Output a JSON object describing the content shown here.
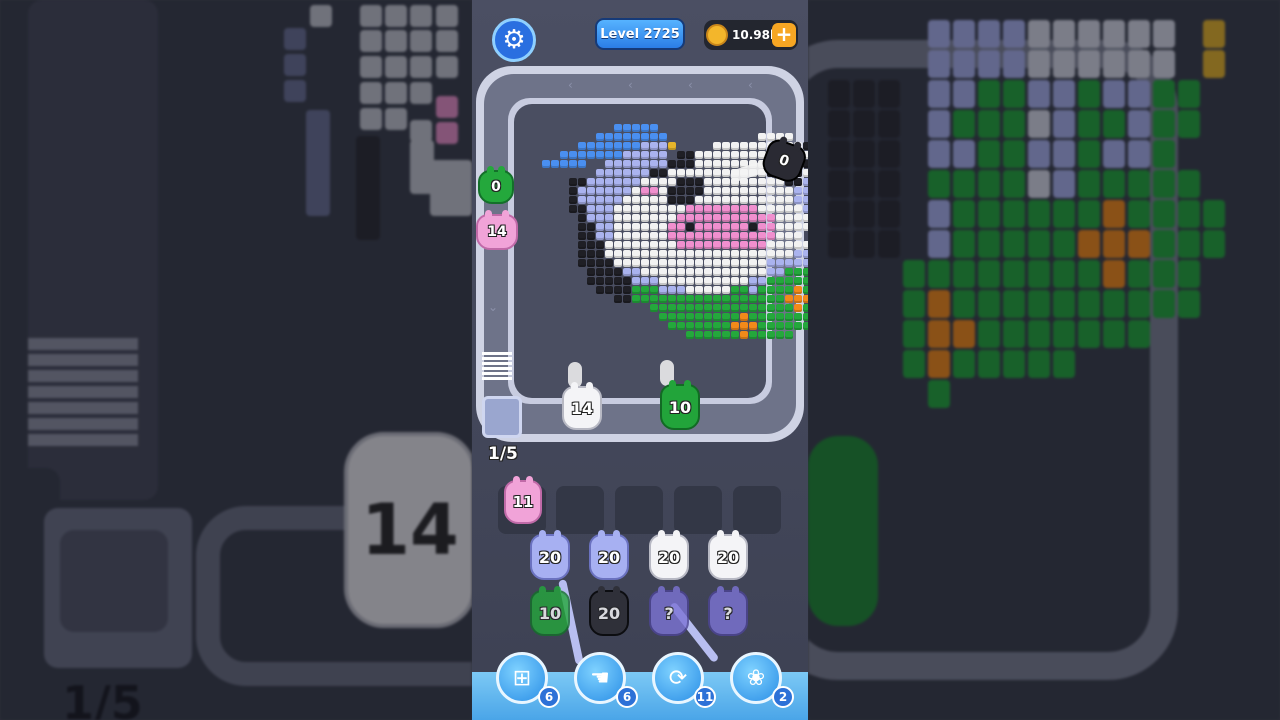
{
  "hud": {
    "level_label": "Level 2725",
    "coins": "10.98k",
    "coin_plus": "+"
  },
  "colors": {
    "cow_white": "#f2f2f2",
    "cow_black": "#1f1f25",
    "cow_pink": "#f08fce",
    "blue": "#4a8ff0",
    "lavender": "#aab3ee",
    "green": "#24a83c",
    "orange": "#f28a1a",
    "yellow": "#e6b52a"
  },
  "conveyor_shooters": [
    {
      "id": "green-left",
      "count": "0",
      "color": "#24a83c"
    },
    {
      "id": "pink-left",
      "count": "14",
      "color": "#f1a3d8"
    },
    {
      "id": "black-right",
      "count": "0",
      "color": "#2a2a33"
    },
    {
      "id": "white-bottom",
      "count": "14",
      "color": "#f4f4f7"
    },
    {
      "id": "green-bottom",
      "count": "10",
      "color": "#22a43a"
    }
  ],
  "queue": {
    "counter": "1/5",
    "slot_pig": {
      "count": "11",
      "color": "#f1a3d8"
    }
  },
  "lanes": [
    [
      {
        "count": "20",
        "color": "#a7b0f2"
      },
      {
        "count": "10",
        "color": "#24a83c"
      }
    ],
    [
      {
        "count": "20",
        "color": "#a7b0f2"
      },
      {
        "count": "20",
        "color": "#2c2c33"
      }
    ],
    [
      {
        "count": "20",
        "color": "#f4f4f7"
      },
      {
        "count": "?",
        "color": "#7d74d6"
      }
    ],
    [
      {
        "count": "20",
        "color": "#f4f4f7"
      },
      {
        "count": "?",
        "color": "#7d74d6"
      }
    ]
  ],
  "boosters": [
    {
      "icon": "add-slot-icon",
      "count": "6"
    },
    {
      "icon": "hand-icon",
      "count": "6"
    },
    {
      "icon": "shuffle-icon",
      "count": "11"
    },
    {
      "icon": "pig-icon",
      "count": "2"
    }
  ],
  "background_mirror": {
    "big_pig_count": "14",
    "counter": "1/5"
  }
}
